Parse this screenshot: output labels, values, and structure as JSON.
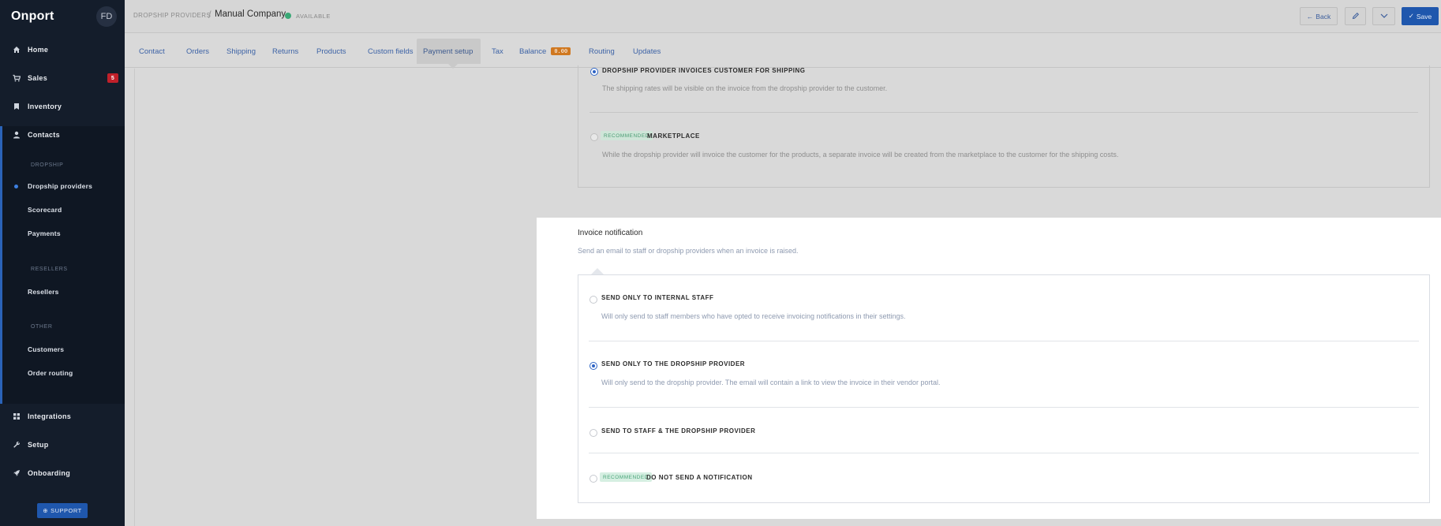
{
  "sidebar": {
    "brand": "Onport",
    "avatar": "FD",
    "nav": [
      {
        "label": "Home",
        "icon": "home-icon"
      },
      {
        "label": "Sales",
        "icon": "cart-icon",
        "badge": "5"
      },
      {
        "label": "Inventory",
        "icon": "bookmark-icon"
      },
      {
        "label": "Contacts",
        "icon": "person-icon"
      }
    ],
    "contacts_sections": {
      "dropship_label": "DROPSHIP",
      "dropship_items": [
        "Dropship providers",
        "Scorecard",
        "Payments"
      ],
      "resellers_label": "RESELLERS",
      "resellers_items": [
        "Resellers"
      ],
      "other_label": "OTHER",
      "other_items": [
        "Customers",
        "Order routing"
      ]
    },
    "bottom_nav": [
      {
        "label": "Integrations",
        "icon": "grid-icon"
      },
      {
        "label": "Setup",
        "icon": "wrench-icon"
      },
      {
        "label": "Onboarding",
        "icon": "rocket-icon"
      }
    ],
    "support_label": "SUPPORT"
  },
  "header": {
    "breadcrumb": "DROPSHIP PROVIDERS",
    "title": "Manual Company",
    "status": "AVAILABLE",
    "back_label": "Back",
    "save_label": "Save"
  },
  "tabs": [
    {
      "label": "Contact"
    },
    {
      "label": "Orders"
    },
    {
      "label": "Shipping"
    },
    {
      "label": "Returns"
    },
    {
      "label": "Products"
    },
    {
      "label": "Custom fields"
    },
    {
      "label": "Payment setup",
      "active": true
    },
    {
      "label": "Tax"
    },
    {
      "label": "Balance",
      "badge": "0.00"
    },
    {
      "label": "Routing"
    },
    {
      "label": "Updates"
    }
  ],
  "shipping_invoice": {
    "options": [
      {
        "title": "DROPSHIP PROVIDER INVOICES CUSTOMER FOR SHIPPING",
        "desc": "The shipping rates will be visible on the invoice from the dropship provider to the customer.",
        "selected": true
      },
      {
        "title": "MARKETPLACE",
        "badge": "RECOMMENDED",
        "desc": "While the dropship provider will invoice the customer for the products, a separate invoice will be created from the marketplace to the customer for the shipping costs.",
        "selected": false
      }
    ]
  },
  "invoice_notification": {
    "title": "Invoice notification",
    "subtitle": "Send an email to staff or dropship providers when an invoice is raised.",
    "options": [
      {
        "title": "SEND ONLY TO INTERNAL STAFF",
        "desc": "Will only send to staff members who have opted to receive invoicing notifications in their settings.",
        "selected": false
      },
      {
        "title": "SEND ONLY TO THE DROPSHIP PROVIDER",
        "desc": "Will only send to the dropship provider. The email will contain a link to view the invoice in their vendor portal.",
        "selected": true
      },
      {
        "title": "SEND TO STAFF & THE DROPSHIP PROVIDER",
        "selected": false
      },
      {
        "title": "DO NOT SEND A NOTIFICATION",
        "badge": "RECOMMENDED",
        "selected": false
      }
    ]
  },
  "colors": {
    "sidebar_bg": "#141d2b",
    "accent": "#1f57ad",
    "badge_red": "#c0202a",
    "badge_orange": "#d07820",
    "recommended_green": "#4aa57a"
  }
}
